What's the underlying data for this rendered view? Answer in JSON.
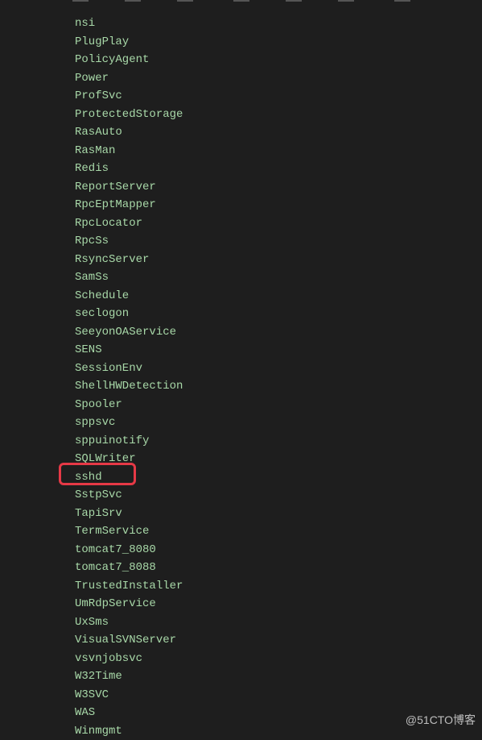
{
  "services": [
    "nsi",
    "PlugPlay",
    "PolicyAgent",
    "Power",
    "ProfSvc",
    "ProtectedStorage",
    "RasAuto",
    "RasMan",
    "Redis",
    "ReportServer",
    "RpcEptMapper",
    "RpcLocator",
    "RpcSs",
    "RsyncServer",
    "SamSs",
    "Schedule",
    "seclogon",
    "SeeyonOAService",
    "SENS",
    "SessionEnv",
    "ShellHWDetection",
    "Spooler",
    "sppsvc",
    "sppuinotify",
    "SQLWriter",
    "sshd",
    "SstpSvc",
    "TapiSrv",
    "TermService",
    "tomcat7_8080",
    "tomcat7_8088",
    "TrustedInstaller",
    "UmRdpService",
    "UxSms",
    "VisualSVNServer",
    "vsvnjobsvc",
    "W32Time",
    "W3SVC",
    "WAS",
    "Winmgmt"
  ],
  "highlighted_index": 25,
  "watermark": "@51CTO博客"
}
